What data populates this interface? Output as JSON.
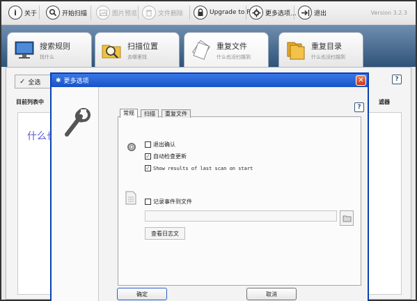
{
  "toolbar": {
    "about": "关于",
    "start_scan": "开始扫描",
    "image_preview": "图片预览",
    "delete_files": "文件删除",
    "upgrade": "Upgrade to Pro",
    "more_options": "更多选项...",
    "exit": "退出",
    "version": "Version 3.2.3"
  },
  "tabs": [
    {
      "title": "搜索规则",
      "sub": "找什么"
    },
    {
      "title": "扫描位置",
      "sub": "去哪里找"
    },
    {
      "title": "重复文件",
      "sub": "什么也没扫描到"
    },
    {
      "title": "重复目录",
      "sub": "什么也没扫描到"
    }
  ],
  "background": {
    "button_label": "全选",
    "list_label": "目前列表中",
    "filter_label": "滤器",
    "placeholder_text": "什么也"
  },
  "dialog": {
    "title": "更多选项",
    "tabs": [
      "常规",
      "扫描",
      "重复文件"
    ],
    "options": {
      "exit_confirm": {
        "label": "退出确认",
        "checked": false
      },
      "auto_update": {
        "label": "自动检查更新",
        "checked": true
      },
      "show_results": {
        "label": "Show results of last scan on start",
        "checked": true
      },
      "log_events": {
        "label": "记录事件到文件",
        "checked": false
      }
    },
    "view_log": "查看日志文",
    "ok": "确定",
    "cancel": "取消"
  },
  "colors": {
    "title_bar": "#1753c8",
    "tabs_band": "#2f5379",
    "checkmark": "#2f7a2f",
    "placeholder": "#5a5ad6"
  }
}
